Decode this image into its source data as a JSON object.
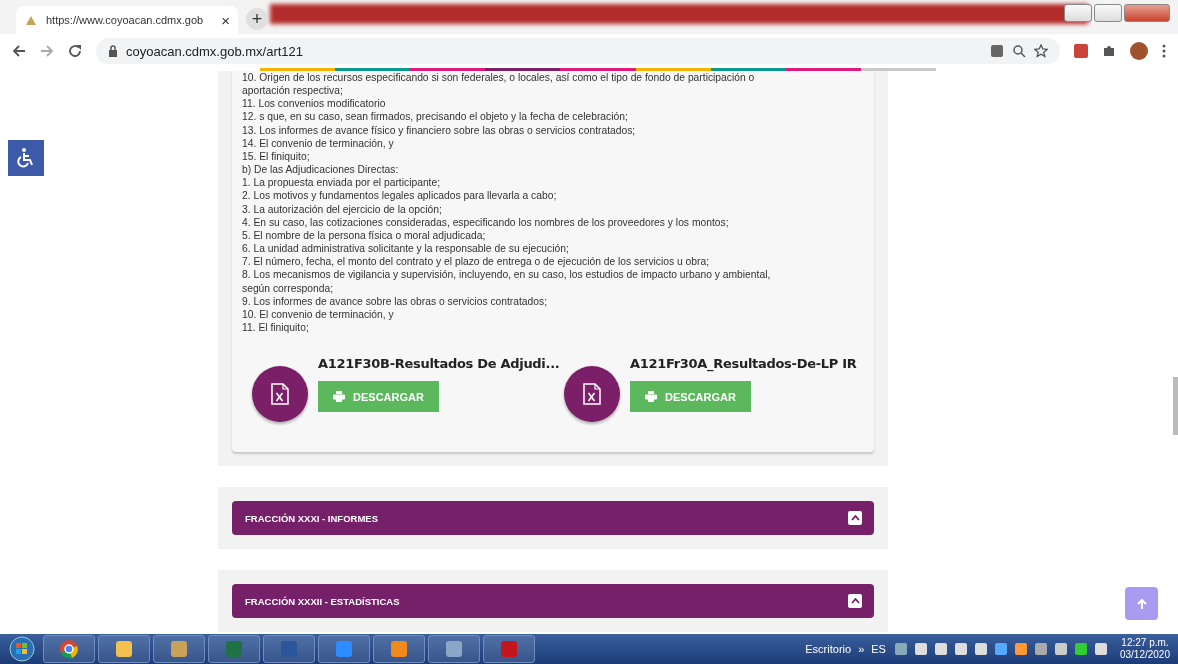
{
  "browser": {
    "tab": {
      "title": "https://www.coyoacan.cdmx.gob",
      "close": "×"
    },
    "new_tab": "+",
    "url": "coyoacan.cdmx.gob.mx/art121"
  },
  "content": {
    "lines": [
      "10. Origen de los recursos especificando si son federales, o locales, así como el tipo de fondo de participación o",
      "aportación respectiva;",
      "11. Los convenios modificatorio",
      "12. s que, en su caso, sean firmados, precisando el objeto y la fecha de celebración;",
      "13. Los informes de avance físico y financiero sobre las obras o servicios contratados;",
      "14. El convenio de terminación, y",
      "15. El finiquito;",
      "b) De las Adjudicaciones Directas:",
      "1. La propuesta enviada por el participante;",
      "2. Los motivos y fundamentos legales aplicados para llevarla a cabo;",
      "3. La autorización del ejercicio de la opción;",
      "4. En su caso, las cotizaciones consideradas, especificando los nombres de los proveedores y los montos;",
      "5. El nombre de la persona física o moral adjudicada;",
      "6. La unidad administrativa solicitante y la responsable de su ejecución;",
      "7. El número, fecha, el monto del contrato y el plazo de entrega o de ejecución de los servicios u obra;",
      "8. Los mecanismos de vigilancia y supervisión, incluyendo, en su caso, los estudios de impacto urbano y ambiental,",
      "según corresponda;",
      "9. Los informes de avance sobre las obras o servicios contratados;",
      "10. El convenio de terminación, y",
      "11. El finiquito;"
    ],
    "files": [
      {
        "title": "A121F30B-Resultados De Adjudi...",
        "button": "DESCARGAR"
      },
      {
        "title": "A121Fr30A_Resultados-De-LP IR",
        "button": "DESCARGAR"
      }
    ]
  },
  "sections": [
    {
      "title": "FRACCIÓN XXXI - INFORMES",
      "expanded": false
    },
    {
      "title": "FRACCIÓN XXXII - ESTADÍSTICAS",
      "expanded": false
    }
  ],
  "taskbar": {
    "desktop": "Escritorio",
    "chevron": "»",
    "language": "ES",
    "time": "12:27 p.m.",
    "date": "03/12/2020"
  }
}
